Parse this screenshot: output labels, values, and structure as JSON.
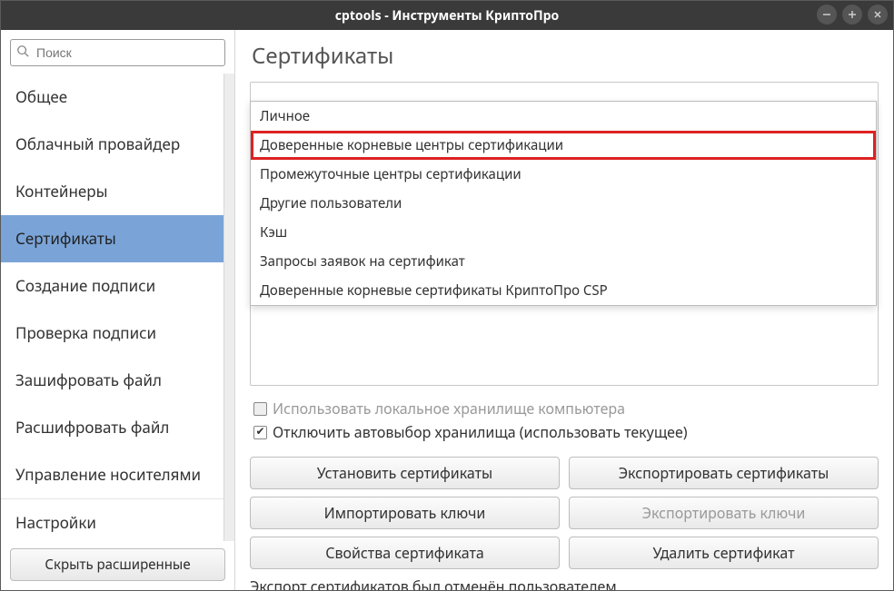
{
  "window_title": "cptools - Инструменты КриптоПро",
  "search": {
    "placeholder": "Поиск"
  },
  "sidebar": {
    "items": [
      {
        "label": "Общее"
      },
      {
        "label": "Облачный провайдер"
      },
      {
        "label": "Контейнеры"
      },
      {
        "label": "Сертификаты",
        "selected": true
      },
      {
        "label": "Создание подписи"
      },
      {
        "label": "Проверка подписи"
      },
      {
        "label": "Зашифровать файл"
      },
      {
        "label": "Расшифровать файл"
      },
      {
        "label": "Управление носителями"
      },
      {
        "label": "Настройки"
      }
    ],
    "hide_advanced": "Скрыть расширенные"
  },
  "page_title": "Сертификаты",
  "dropdown": {
    "items": [
      "Личное",
      "Доверенные корневые центры сертификации",
      "Промежуточные центры сертификации",
      "Другие пользователи",
      "Кэш",
      "Запросы заявок на сертификат",
      "Доверенные корневые сертификаты КриптоПро CSP"
    ],
    "highlighted_index": 1
  },
  "checkboxes": {
    "use_local_store": {
      "label": "Использовать локальное хранилище компьютера",
      "checked": false,
      "disabled": true
    },
    "disable_autoselect": {
      "label": "Отключить автовыбор хранилища (использовать текущее)",
      "checked": true,
      "disabled": false
    }
  },
  "buttons": {
    "install": "Установить сертификаты",
    "export_certs": "Экспортировать сертификаты",
    "import_keys": "Импортировать ключи",
    "export_keys": "Экспортировать ключи",
    "properties": "Свойства сертификата",
    "delete": "Удалить сертификат"
  },
  "status_text": "Экспорт сертификатов был отменён пользователем"
}
